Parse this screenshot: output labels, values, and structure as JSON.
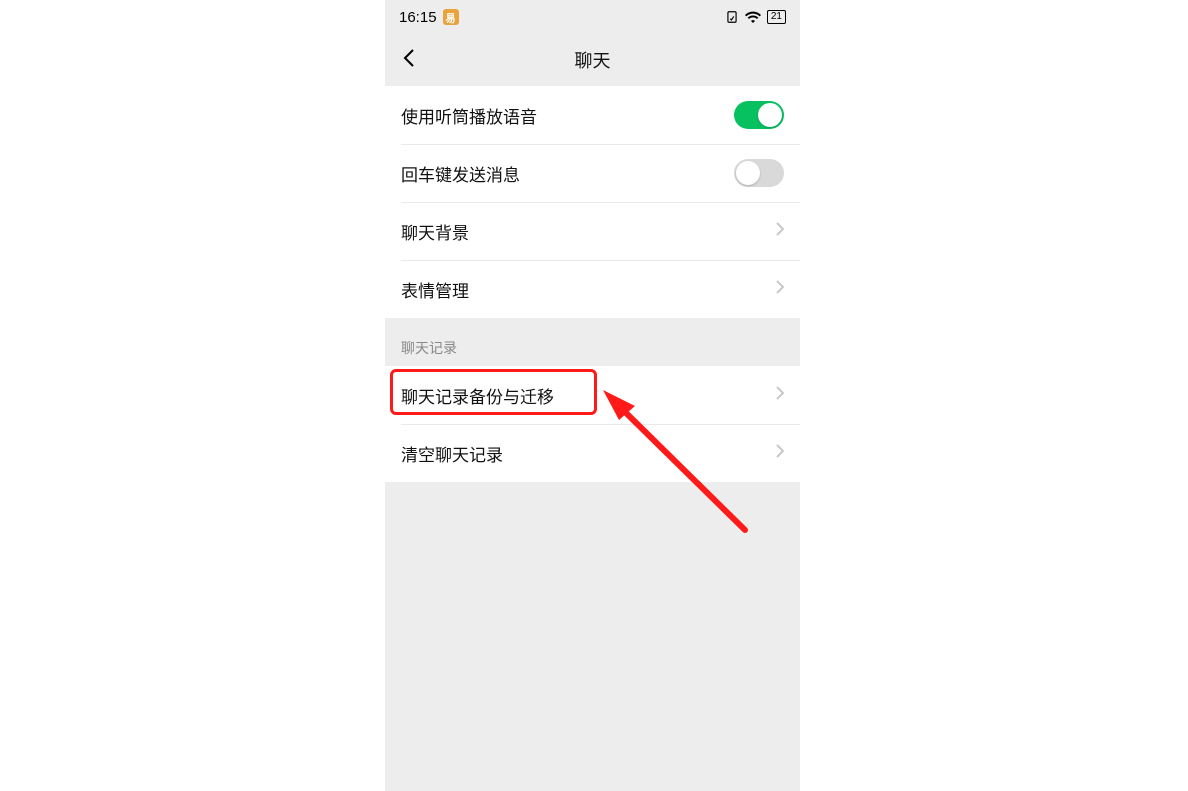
{
  "status": {
    "time": "16:15",
    "battery_text": "21"
  },
  "nav": {
    "title": "聊天"
  },
  "settings_group1": [
    {
      "label": "使用听筒播放语音",
      "type": "toggle",
      "value": "on"
    },
    {
      "label": "回车键发送消息",
      "type": "toggle",
      "value": "off"
    },
    {
      "label": "聊天背景",
      "type": "nav"
    },
    {
      "label": "表情管理",
      "type": "nav"
    }
  ],
  "section_header": "聊天记录",
  "settings_group2": [
    {
      "label": "聊天记录备份与迁移",
      "type": "nav",
      "highlighted": true
    },
    {
      "label": "清空聊天记录",
      "type": "nav"
    }
  ],
  "annotation": {
    "highlight_item_label": "聊天记录备份与迁移",
    "arrow_color": "#ff1a1a"
  }
}
